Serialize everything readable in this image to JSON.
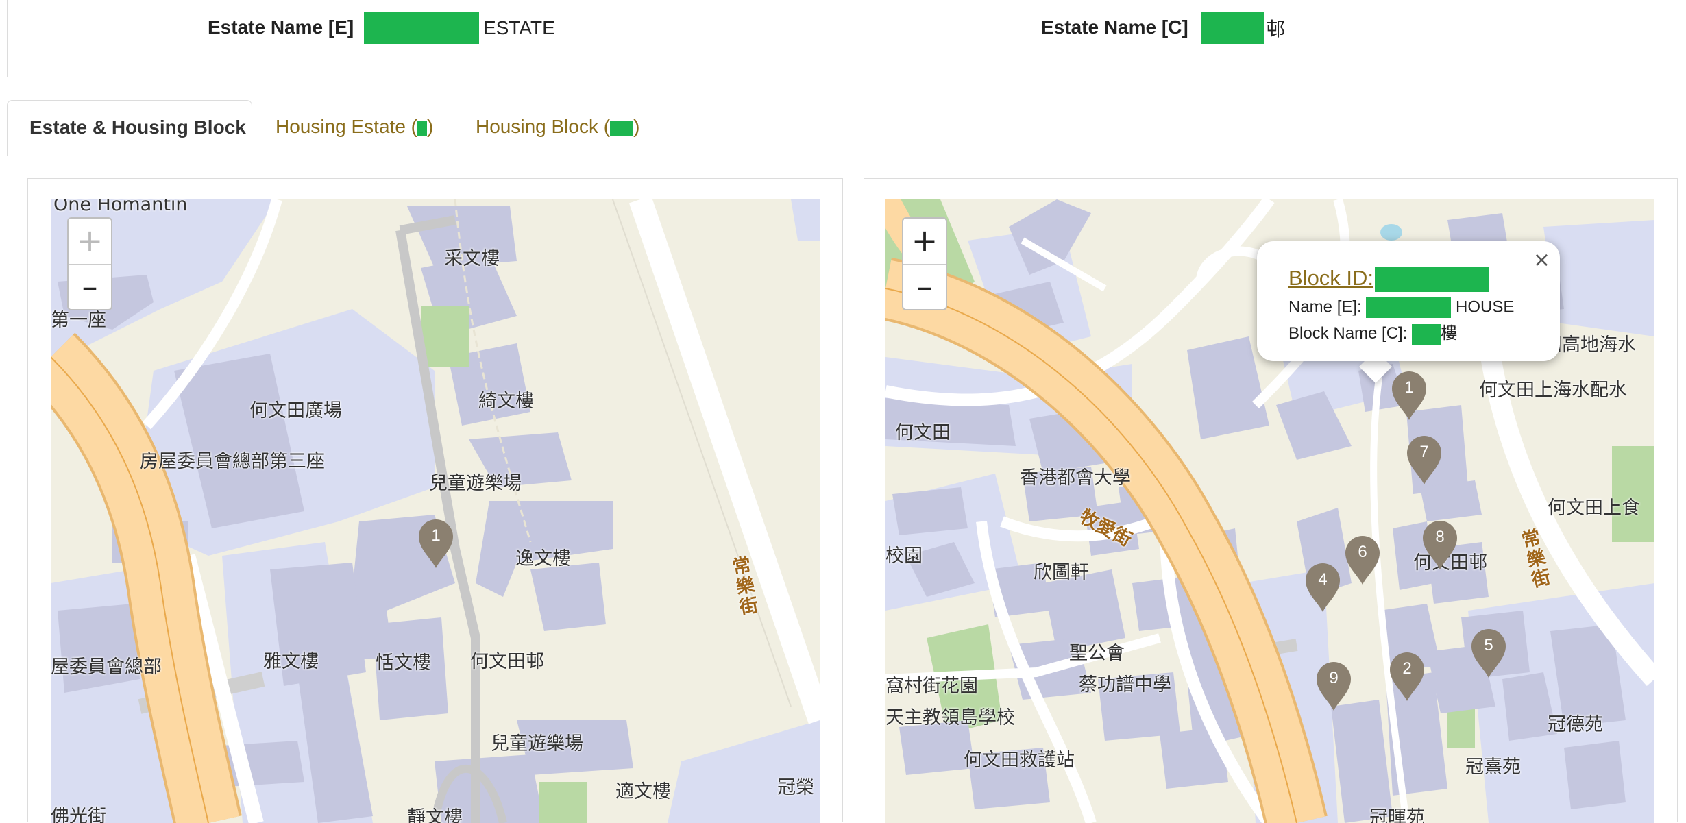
{
  "header": {
    "estate_name_e_label": "Estate Name [E]",
    "estate_name_e_suffix": "ESTATE",
    "estate_name_c_label": "Estate Name [C]",
    "estate_name_c_suffix": "邨"
  },
  "tabs": [
    {
      "label": "Estate & Housing Block",
      "active": true
    },
    {
      "label": "Housing Estate",
      "active": false
    },
    {
      "label": "Housing Block",
      "active": false
    }
  ],
  "colors": {
    "accent": "#8a6d1b",
    "redaction": "#1db54f",
    "marker": "#8b8070"
  },
  "left_map": {
    "zoom_in": "+",
    "zoom_out": "–",
    "zoom_in_disabled": true,
    "labels": {
      "one_homantin": "One Homantin",
      "choi_man": "采文樓",
      "ho_man_tin_plaza": "何文田廣場",
      "kai_man": "綺文樓",
      "hq_block3": "房屋委員會總部第三座",
      "playground1": "兒童遊樂場",
      "yat_man": "逸文樓",
      "sheung_lok": "常樂街",
      "nga_man": "雅文樓",
      "tim_man": "恬文樓",
      "estate": "何文田邨",
      "hq": "屋委員會總部",
      "playground2": "兒童遊樂場",
      "sik_man": "適文樓",
      "first_block": "第一座",
      "kwun": "冠榮",
      "fat_kwong": "佛光街",
      "ching_man": "靜文樓"
    },
    "markers": [
      "1"
    ]
  },
  "right_map": {
    "zoom_in": "+",
    "zoom_out": "–",
    "labels": {
      "ho_man_tin": "何文田",
      "hkbu": "香港都會大學",
      "muk_oi": "牧愛街",
      "yan_to": "欣圖軒",
      "campus": "校園",
      "estate": "何文田邨",
      "holy_trinity": "聖公會",
      "choi_kung_tsun": "蔡功譜中學",
      "villa": "窩村街花園",
      "catholic": "天主教領島學校",
      "ambulance": "何文田救護站",
      "high_level": "田高地海水",
      "salt_water": "何文田上海水配水",
      "ho_man_tin_upper": "何文田上食",
      "sheung_lok": "常樂街",
      "kwun_tak": "冠德苑",
      "kwun_hei": "冠熹苑",
      "kwun_fai": "冠暉苑"
    },
    "markers": [
      "1",
      "7",
      "8",
      "6",
      "4",
      "5",
      "2",
      "9"
    ]
  },
  "popup": {
    "block_id_label": "Block ID:",
    "name_e_label": "Name [E]:",
    "name_e_suffix": "HOUSE",
    "block_name_c_label": "Block Name [C]:",
    "block_name_c_suffix": "樓",
    "close": "×"
  }
}
